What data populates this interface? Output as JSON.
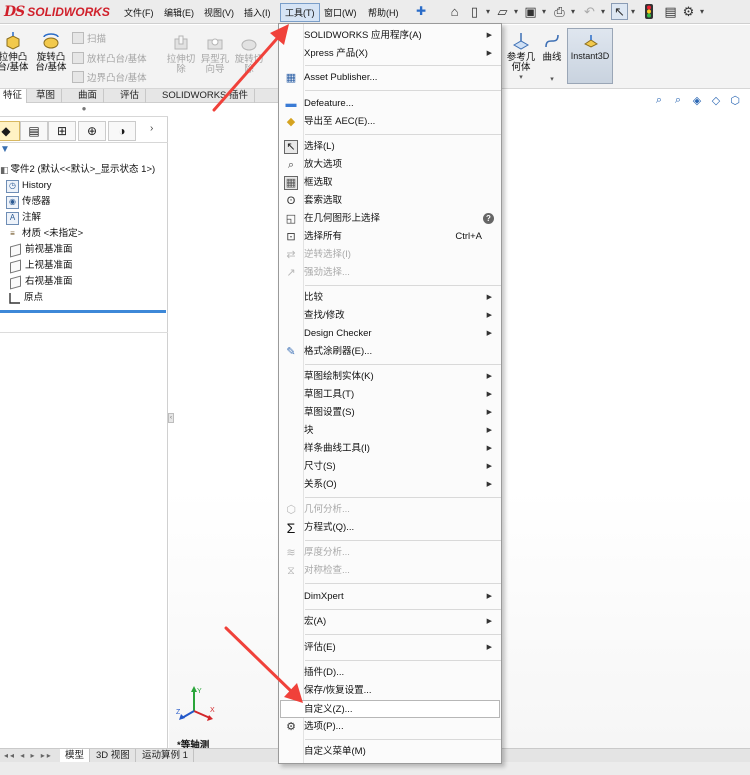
{
  "app": {
    "logo_ds": "DS",
    "logo_text": "SOLIDWORKS"
  },
  "menubar": {
    "file": "文件(F)",
    "edit": "编辑(E)",
    "view": "视图(V)",
    "insert": "插入(I)",
    "tools": "工具(T)",
    "window": "窗口(W)",
    "help": "帮助(H)"
  },
  "command_manager": {
    "extrude_boss": "拉伸凸\n台/基体",
    "revolve_boss": "旋转凸\n台/基体",
    "sweep": "扫描",
    "loft": "放样凸台/基体",
    "boundary": "边界凸台/基体",
    "extrude_cut": "拉伸切\n除",
    "hole_wizard": "异型孔\n向导",
    "revolve_cut": "旋转切\n除",
    "ref_geometry": "参考几\n何体",
    "curves": "曲线",
    "instant3d": "Instant3D"
  },
  "tabs": [
    "特征",
    "草图",
    "曲面",
    "评估",
    "SOLIDWORKS 插件"
  ],
  "feature_tree": {
    "root": "零件2 (默认<<默认>_显示状态 1>)",
    "items": [
      "History",
      "传感器",
      "注解",
      "材质 <未指定>",
      "前视基准面",
      "上视基准面",
      "右视基准面",
      "原点"
    ]
  },
  "graphics": {
    "view_label": "*等轴测",
    "triad_x": "X",
    "triad_y": "Y",
    "triad_z": "Z"
  },
  "bottom_tabs": [
    "模型",
    "3D 视图",
    "运动算例 1"
  ],
  "tools_menu": {
    "items": [
      {
        "label": "SOLIDWORKS 应用程序(A)",
        "submenu": true
      },
      {
        "label": "Xpress 产品(X)",
        "submenu": true
      },
      {
        "label": "Asset Publisher...",
        "icon": "asset-publisher-icon"
      },
      {
        "label": "Defeature...",
        "icon": "defeature-icon"
      },
      {
        "label": "导出至 AEC(E)...",
        "icon": "export-aec-icon"
      },
      {
        "label": "选择(L)",
        "icon": "select-arrow-icon"
      },
      {
        "label": "放大选项",
        "icon": "magnify-select-icon"
      },
      {
        "label": "框选取",
        "icon": "box-select-icon"
      },
      {
        "label": "套索选取",
        "icon": "lasso-select-icon"
      },
      {
        "label": "在几何图形上选择",
        "icon": "select-geometry-icon"
      },
      {
        "label": "选择所有",
        "icon": "select-all-icon",
        "shortcut": "Ctrl+A"
      },
      {
        "label": "逆转选择(I)",
        "icon": "invert-select-icon",
        "disabled": true
      },
      {
        "label": "强劲选择...",
        "icon": "power-select-icon",
        "disabled": true
      },
      {
        "label": "比较",
        "submenu": true
      },
      {
        "label": "查找/修改",
        "submenu": true
      },
      {
        "label": "Design Checker",
        "submenu": true
      },
      {
        "label": "格式涂刷器(E)...",
        "icon": "format-painter-icon"
      },
      {
        "label": "草图绘制实体(K)",
        "submenu": true
      },
      {
        "label": "草图工具(T)",
        "submenu": true
      },
      {
        "label": "草图设置(S)",
        "submenu": true
      },
      {
        "label": "块",
        "submenu": true
      },
      {
        "label": "样条曲线工具(I)",
        "submenu": true
      },
      {
        "label": "尺寸(S)",
        "submenu": true
      },
      {
        "label": "关系(O)",
        "submenu": true
      },
      {
        "label": "几何分析...",
        "icon": "geometry-analysis-icon",
        "disabled": true
      },
      {
        "label": "方程式(Q)...",
        "icon": "equations-icon"
      },
      {
        "label": "厚度分析...",
        "icon": "thickness-analysis-icon",
        "disabled": true
      },
      {
        "label": "对称检查...",
        "icon": "symmetry-check-icon",
        "disabled": true
      },
      {
        "label": "DimXpert",
        "submenu": true
      },
      {
        "label": "宏(A)",
        "submenu": true
      },
      {
        "label": "评估(E)",
        "submenu": true
      },
      {
        "label": "插件(D)..."
      },
      {
        "label": "保存/恢复设置..."
      },
      {
        "label": "自定义(Z)...",
        "highlighted": true
      },
      {
        "label": "选项(P)...",
        "icon": "options-gear-icon"
      },
      {
        "label": "自定义菜单(M)"
      }
    ]
  },
  "colors": {
    "brand": "#d0202b",
    "accent": "#3d88d8",
    "annotation_arrow": "#f0413a"
  }
}
